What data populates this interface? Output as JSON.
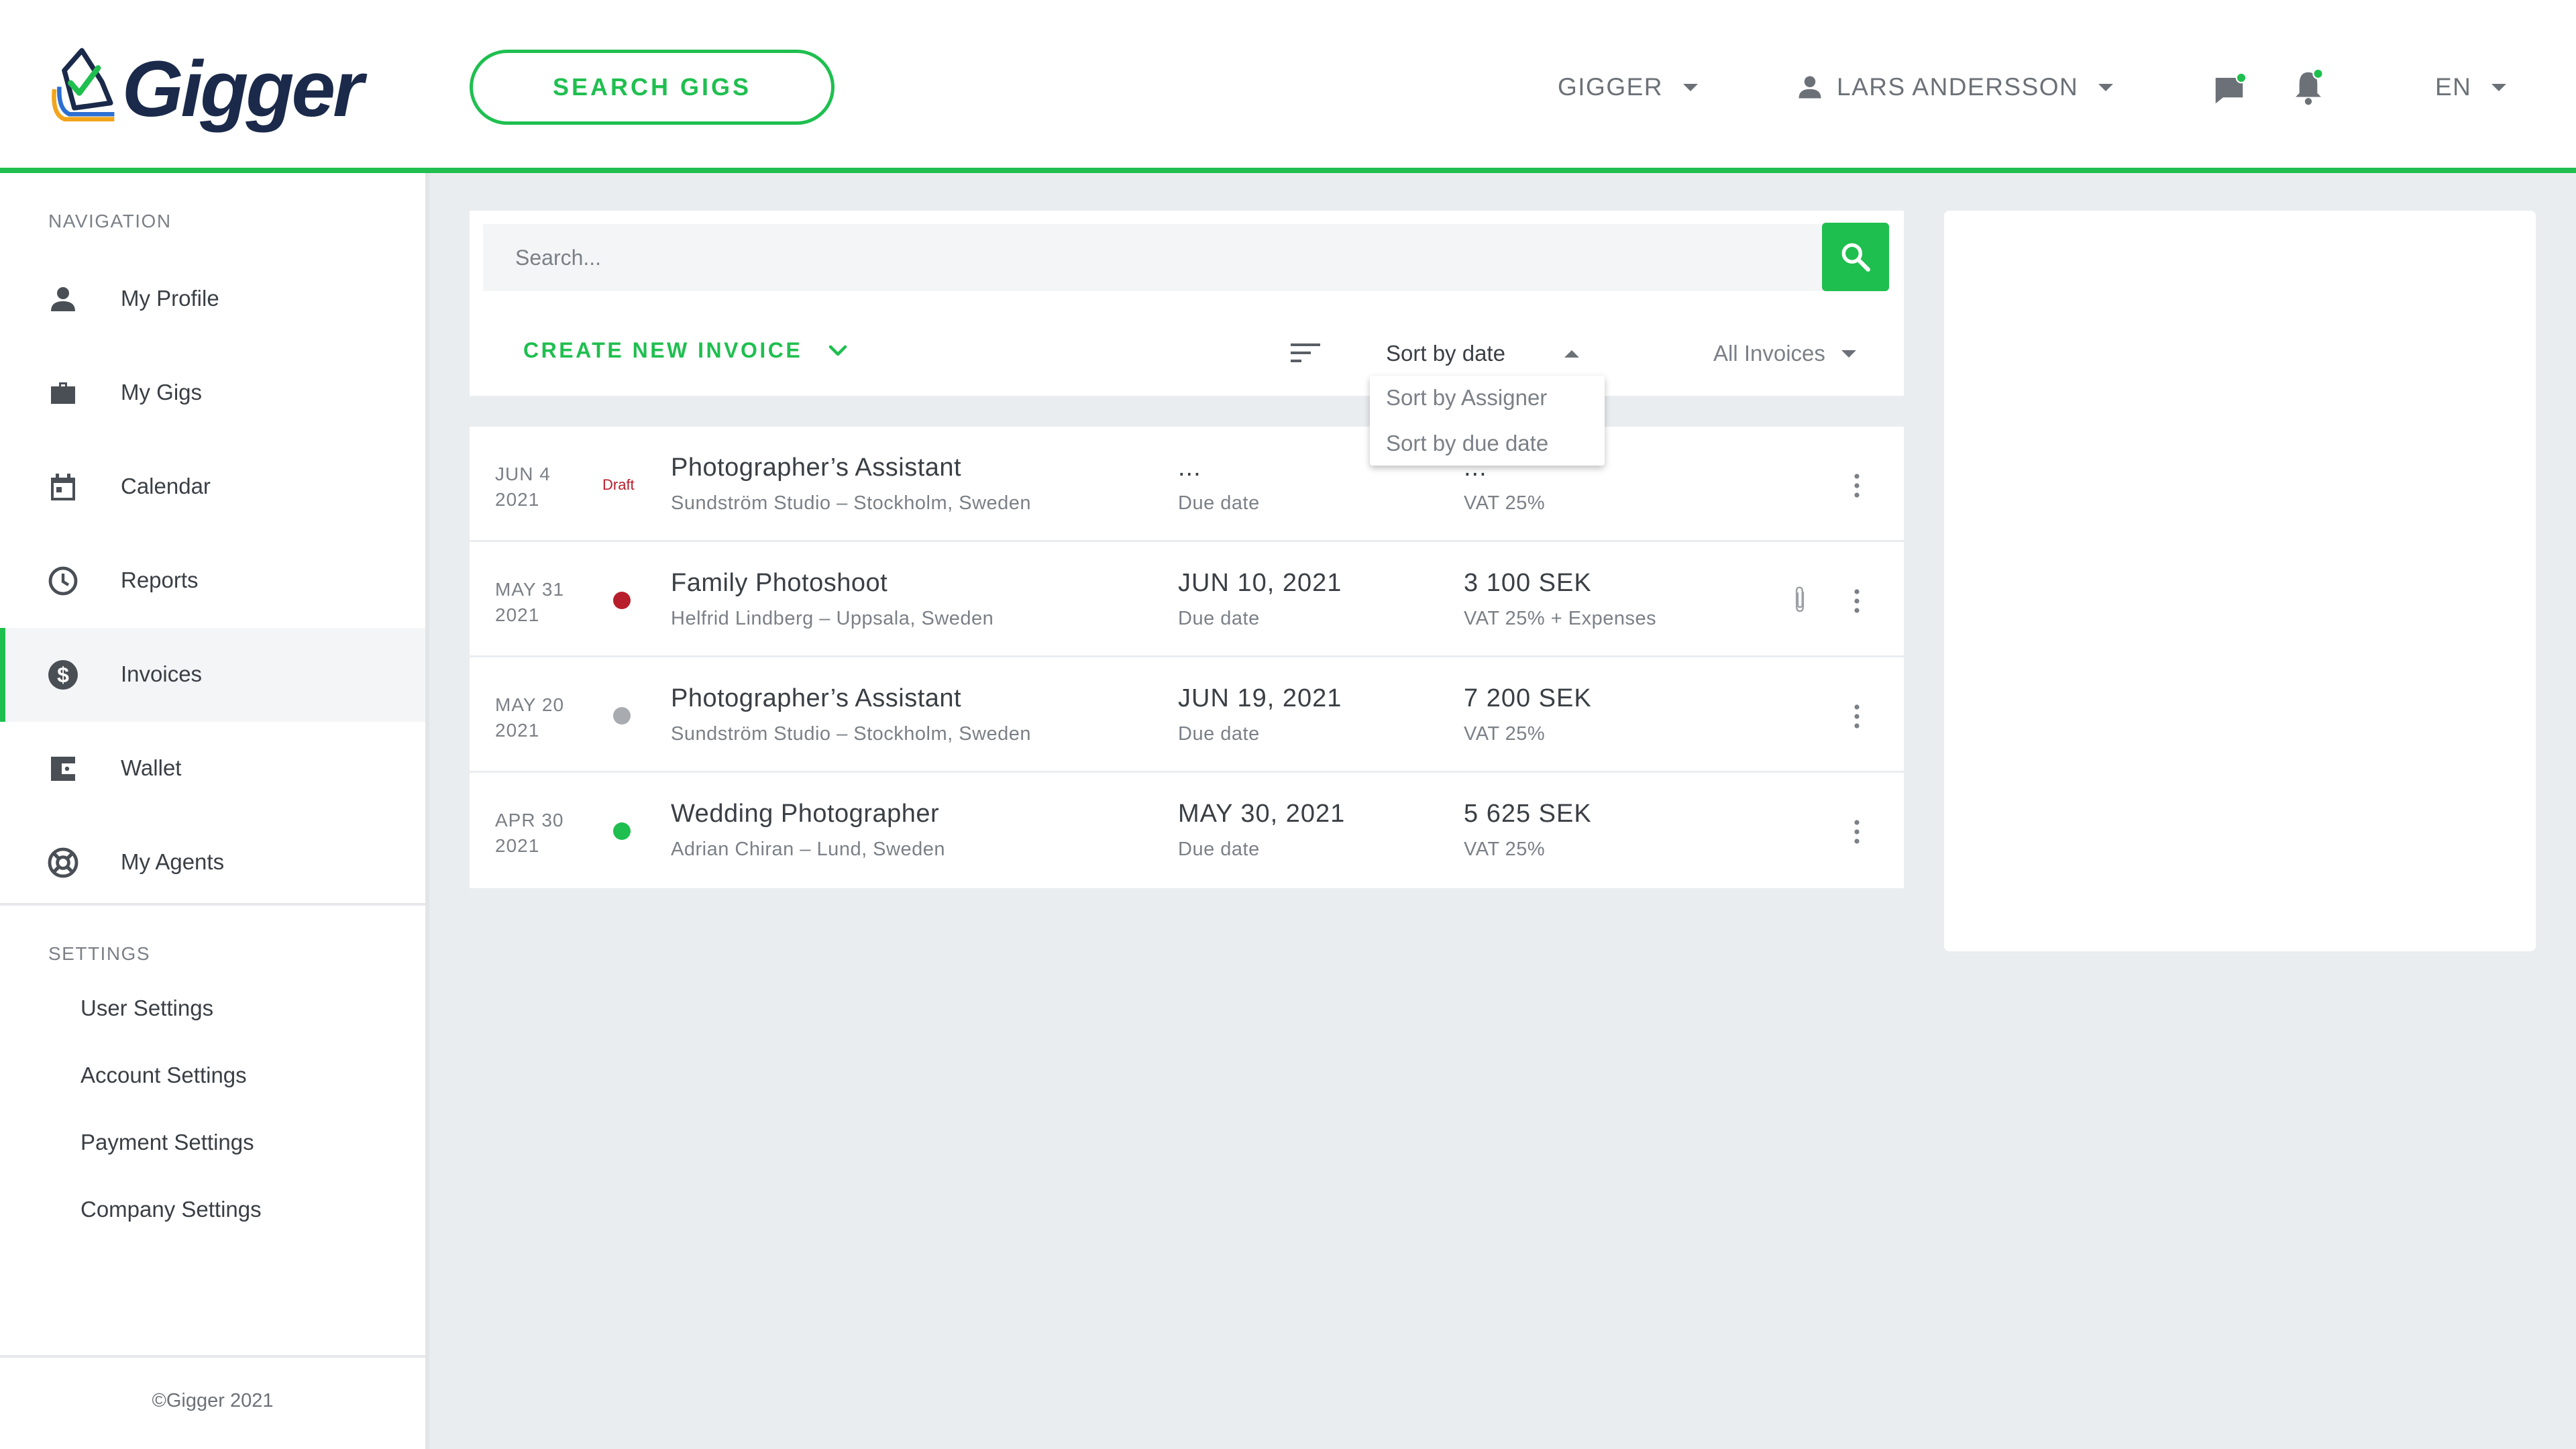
{
  "header": {
    "logo_text": "Gigger",
    "search_gigs_label": "SEARCH GIGS",
    "org_label": "GIGGER",
    "user_label": "LARS ANDERSSON",
    "lang_label": "EN",
    "accent_color": "#1fbf4f",
    "notification_dot_color": "#1fbf4f"
  },
  "sidebar": {
    "nav_heading": "NAVIGATION",
    "items": [
      {
        "label": "My Profile",
        "icon": "person-icon"
      },
      {
        "label": "My Gigs",
        "icon": "briefcase-icon"
      },
      {
        "label": "Calendar",
        "icon": "calendar-icon"
      },
      {
        "label": "Reports",
        "icon": "clock-icon"
      },
      {
        "label": "Invoices",
        "icon": "dollar-icon",
        "active": true
      },
      {
        "label": "Wallet",
        "icon": "wallet-icon"
      },
      {
        "label": "My Agents",
        "icon": "lifebuoy-icon"
      }
    ],
    "settings_heading": "SETTINGS",
    "settings": [
      {
        "label": "User Settings"
      },
      {
        "label": "Account Settings"
      },
      {
        "label": "Payment Settings"
      },
      {
        "label": "Company Settings"
      }
    ],
    "footer": "©Gigger 2021"
  },
  "toolbar": {
    "search_placeholder": "Search...",
    "create_label": "CREATE NEW INVOICE",
    "sort_selected": "Sort by date",
    "sort_options": [
      "Sort by Assigner",
      "Sort by due date"
    ],
    "filter_selected": "All Invoices"
  },
  "invoices": [
    {
      "date_line1": "JUN 4",
      "date_line2": "2021",
      "status": "Draft",
      "status_color": "#b81d2b",
      "title": "Photographer’s Assistant",
      "subtitle": "Sundström Studio – Stockholm, Sweden",
      "due": "...",
      "due_label": "Due date",
      "amount": "...",
      "vat": "VAT 25%",
      "attachment": false
    },
    {
      "date_line1": "MAY 31",
      "date_line2": "2021",
      "status": "overdue",
      "status_color": "#b81d2b",
      "title": "Family Photoshoot",
      "subtitle": "Helfrid Lindberg – Uppsala, Sweden",
      "due": "JUN 10, 2021",
      "due_label": "Due date",
      "amount": "3 100 SEK",
      "vat": "VAT 25% + Expenses",
      "attachment": true
    },
    {
      "date_line1": "MAY 20",
      "date_line2": "2021",
      "status": "pending",
      "status_color": "#a8acb1",
      "title": "Photographer’s Assistant",
      "subtitle": "Sundström Studio – Stockholm, Sweden",
      "due": "JUN 19, 2021",
      "due_label": "Due date",
      "amount": "7 200 SEK",
      "vat": "VAT 25%",
      "attachment": false
    },
    {
      "date_line1": "APR 30",
      "date_line2": "2021",
      "status": "paid",
      "status_color": "#1fbf4f",
      "title": "Wedding Photographer",
      "subtitle": "Adrian Chiran – Lund, Sweden",
      "due": "MAY 30, 2021",
      "due_label": "Due date",
      "amount": "5 625 SEK",
      "vat": "VAT 25%",
      "attachment": false
    }
  ]
}
